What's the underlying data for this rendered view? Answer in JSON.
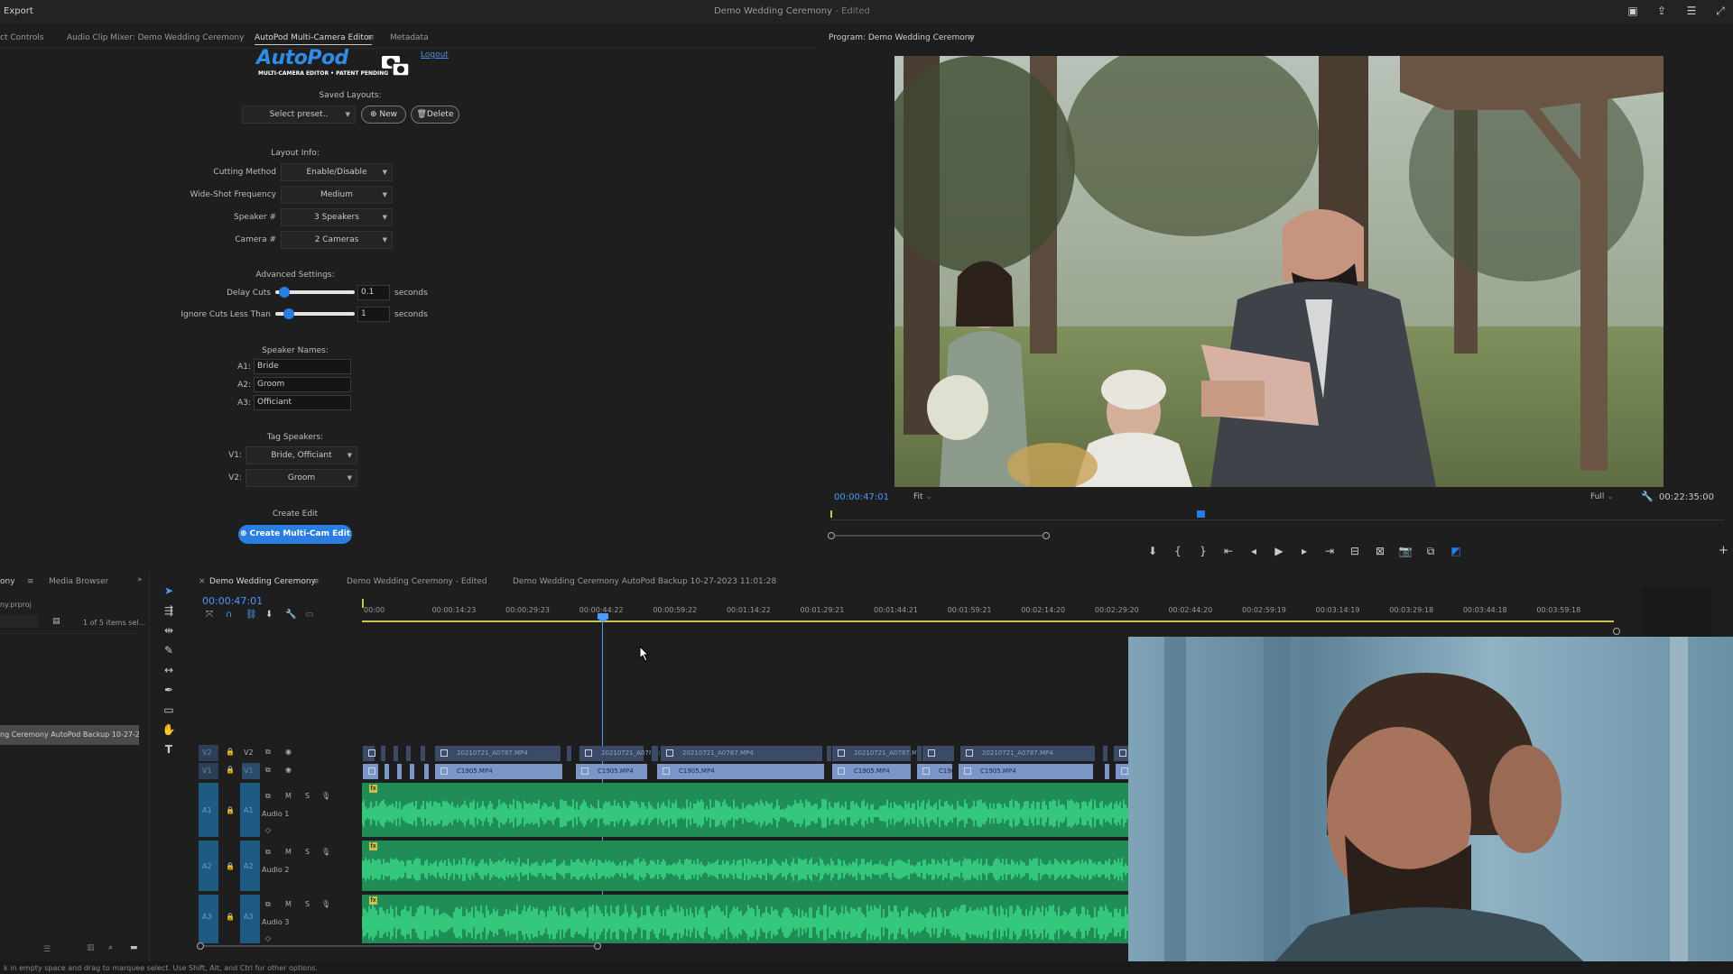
{
  "titlebar": {
    "menu_export": "Export",
    "doc_title": "Demo Wedding Ceremony",
    "doc_state": "- Edited",
    "icons": [
      "workspaces-icon",
      "share-icon",
      "menu-icon",
      "fullscreen-icon"
    ]
  },
  "source_panel": {
    "tabs": [
      "ct Controls",
      "Audio Clip Mixer: Demo Wedding Ceremony",
      "AutoPod Multi-Camera Editor",
      "Metadata"
    ],
    "active_tab": 2,
    "tab_menu_icon": "≡"
  },
  "autopod": {
    "logo_text": "AutoPod",
    "logo_sub": "MULTI-CAMERA EDITOR • PATENT PENDING",
    "logout": "Logout",
    "saved_layouts_label": "Saved Layouts:",
    "preset_select": "Select preset..",
    "new_button": "New",
    "delete_button": "Delete",
    "layout_info_label": "Layout Info:",
    "fields": [
      {
        "label": "Cutting Method",
        "value": "Enable/Disable"
      },
      {
        "label": "Wide-Shot Frequency",
        "value": "Medium"
      },
      {
        "label": "Speaker #",
        "value": "3 Speakers"
      },
      {
        "label": "Camera #",
        "value": "2 Cameras"
      }
    ],
    "advanced_label": "Advanced Settings:",
    "delay_cuts": {
      "label": "Delay Cuts",
      "value": "0.1",
      "unit": "seconds",
      "level": 0.05
    },
    "ignore_cuts": {
      "label": "Ignore Cuts Less Than",
      "value": "1",
      "unit": "seconds",
      "level": 0.12
    },
    "speaker_names_label": "Speaker Names:",
    "speakers": [
      {
        "label": "A1:",
        "value": "Bride"
      },
      {
        "label": "A2:",
        "value": "Groom"
      },
      {
        "label": "A3:",
        "value": "Officiant"
      }
    ],
    "tag_speakers_label": "Tag Speakers:",
    "tags": [
      {
        "label": "V1:",
        "value": "Bride, Officiant"
      },
      {
        "label": "V2:",
        "value": "Groom"
      }
    ],
    "create_edit_label": "Create Edit",
    "create_button": "Create Multi-Cam Edit"
  },
  "program": {
    "tab_title": "Program: Demo Wedding Ceremony",
    "timecode": "00:00:47:01",
    "fit": "Fit",
    "quality": "Full",
    "duration": "00:22:35:00",
    "playhead_fraction": 0.41
  },
  "project_panel": {
    "tabs": [
      "ony",
      "Media Browser"
    ],
    "file": "ny.prproj",
    "items_count": "1 of 5 items sel...",
    "selected_item": "ng Ceremony AutoPod Backup 10-27-20"
  },
  "timeline": {
    "tabs": [
      "Demo Wedding Ceremony",
      "Demo Wedding Ceremony - Edited",
      "Demo Wedding Ceremony AutoPod Backup 10-27-2023 11:01:28"
    ],
    "timecode": "00:00:47:01",
    "ruler": [
      "00:00",
      "00:00:14:23",
      "00:00:29:23",
      "00:00:44:22",
      "00:00:59:22",
      "00:01:14:22",
      "00:01:29:21",
      "00:01:44:21",
      "00:01:59:21",
      "00:02:14:20",
      "00:02:29:20",
      "00:02:44:20",
      "00:02:59:19",
      "00:03:14:19",
      "00:03:29:18",
      "00:03:44:18",
      "00:03:59:18"
    ],
    "tracks": {
      "video": [
        "V2",
        "V1"
      ],
      "audio": [
        {
          "id": "A1",
          "name": "Audio 1"
        },
        {
          "id": "A2",
          "name": "Audio 2"
        },
        {
          "id": "A3",
          "name": "Audio 3"
        }
      ]
    },
    "v2_clip_name": "20210721_A0787.MP4",
    "v1_clip_name": "C1905.MP4",
    "track_toggle_m": "M",
    "track_toggle_s": "S"
  },
  "status_bar": "k in empty space and drag to marquee select. Use Shift, Alt, and Ctrl for other options.",
  "colors": {
    "accent": "#2a7de1",
    "audio": "#1f8d55",
    "waveform": "#3ee08e",
    "v1clip": "#7d96c8",
    "v2clip": "#3b4a66",
    "timecode": "#4a9bff"
  }
}
